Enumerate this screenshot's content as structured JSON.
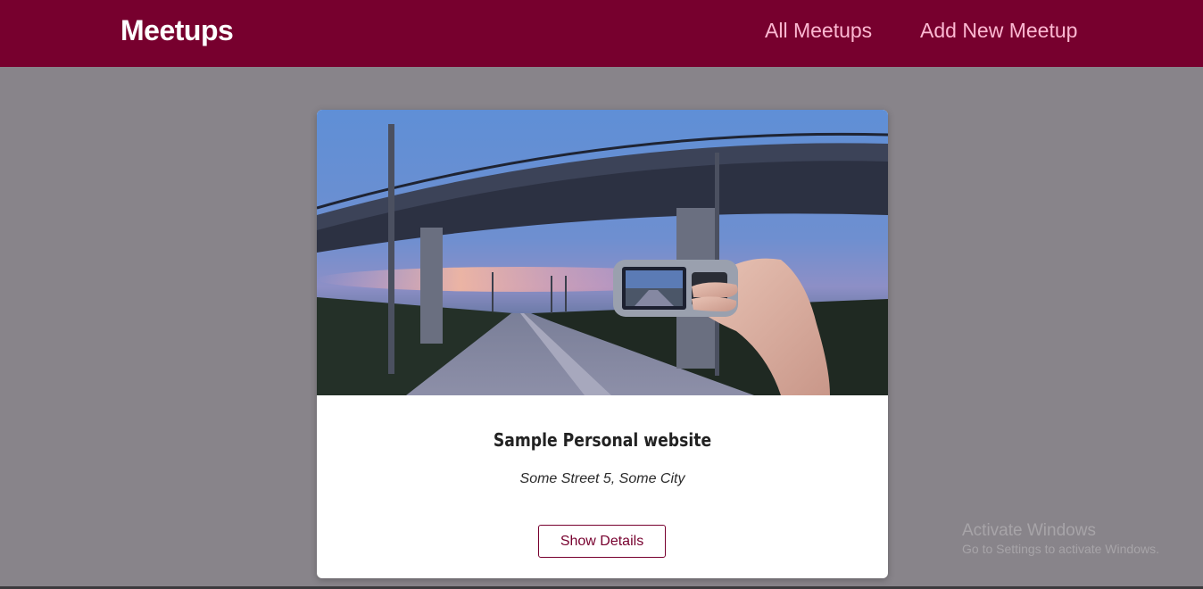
{
  "header": {
    "logo": "Meetups",
    "nav": {
      "all_meetups": "All Meetups",
      "add_new_meetup": "Add New Meetup"
    }
  },
  "meetup": {
    "title": "Sample Personal website",
    "address": "Some Street 5, Some City",
    "button_label": "Show Details",
    "image": "photo of a hand holding a phone photographing a road under a bridge at dusk"
  },
  "watermark": {
    "title": "Activate Windows",
    "subtitle": "Go to Settings to activate Windows."
  },
  "colors": {
    "header_bg": "#77002e",
    "nav_text": "#fcb8d2",
    "page_bg": "#88848a",
    "accent": "#77002e"
  }
}
